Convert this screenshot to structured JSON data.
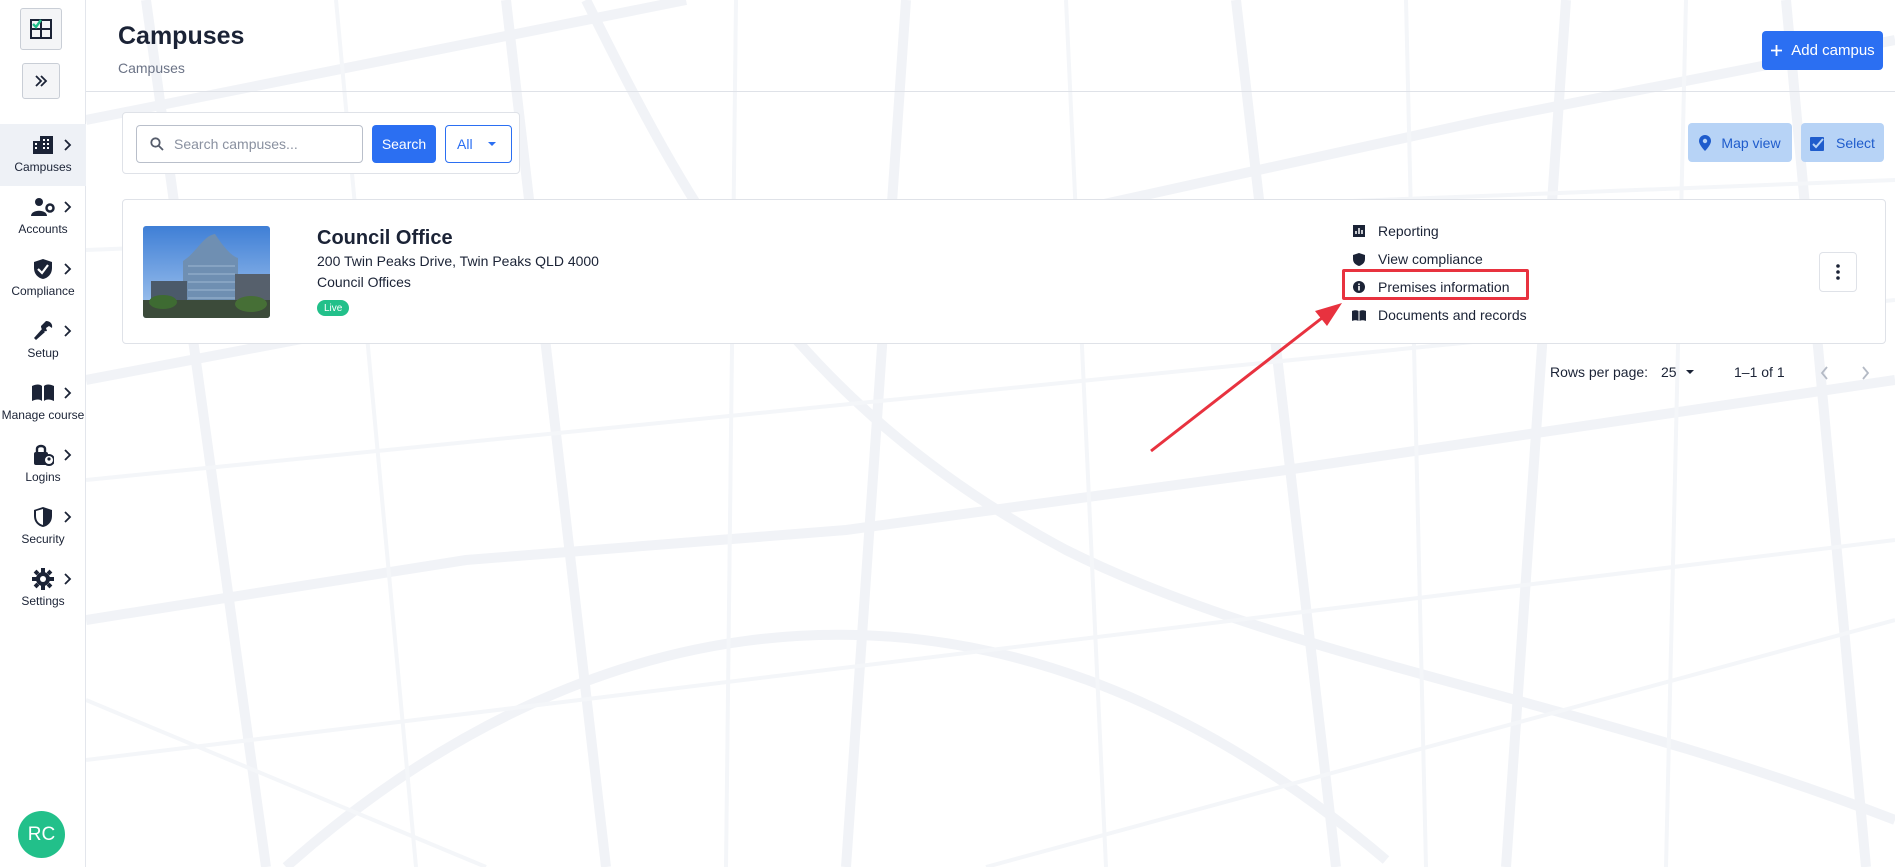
{
  "header": {
    "title": "Campuses",
    "breadcrumb": "Campuses",
    "add_label": "Add campus"
  },
  "sidebar": {
    "items": [
      {
        "label": "Campuses",
        "icon": "buildings-icon",
        "active": true
      },
      {
        "label": "Accounts",
        "icon": "user-cog-icon"
      },
      {
        "label": "Compliance",
        "icon": "shield-check-icon"
      },
      {
        "label": "Setup",
        "icon": "wrench-icon"
      },
      {
        "label": "Manage course",
        "icon": "book-icon"
      },
      {
        "label": "Logins",
        "icon": "lock-person-icon"
      },
      {
        "label": "Security",
        "icon": "shield-icon"
      },
      {
        "label": "Settings",
        "icon": "gear-icon"
      }
    ],
    "avatar_initials": "RC"
  },
  "toolbar": {
    "search_placeholder": "Search campuses...",
    "search_value": "",
    "search_label": "Search",
    "filter_value": "All",
    "map_view_label": "Map view",
    "select_label": "Select"
  },
  "campus": {
    "name": "Council Office",
    "address": "200 Twin Peaks Drive, Twin Peaks QLD 4000",
    "type": "Council Offices",
    "status": "Live",
    "links": [
      {
        "label": "Reporting",
        "icon": "report-icon"
      },
      {
        "label": "View compliance",
        "icon": "shield-icon"
      },
      {
        "label": "Premises information",
        "icon": "info-icon",
        "highlighted": true
      },
      {
        "label": "Documents and records",
        "icon": "documents-icon"
      }
    ]
  },
  "pagination": {
    "rows_label": "Rows per page:",
    "rows_value": "25",
    "range": "1–1 of 1"
  },
  "colors": {
    "primary": "#2b6ff2",
    "live": "#22c08a",
    "annotation": "#e8323f"
  }
}
